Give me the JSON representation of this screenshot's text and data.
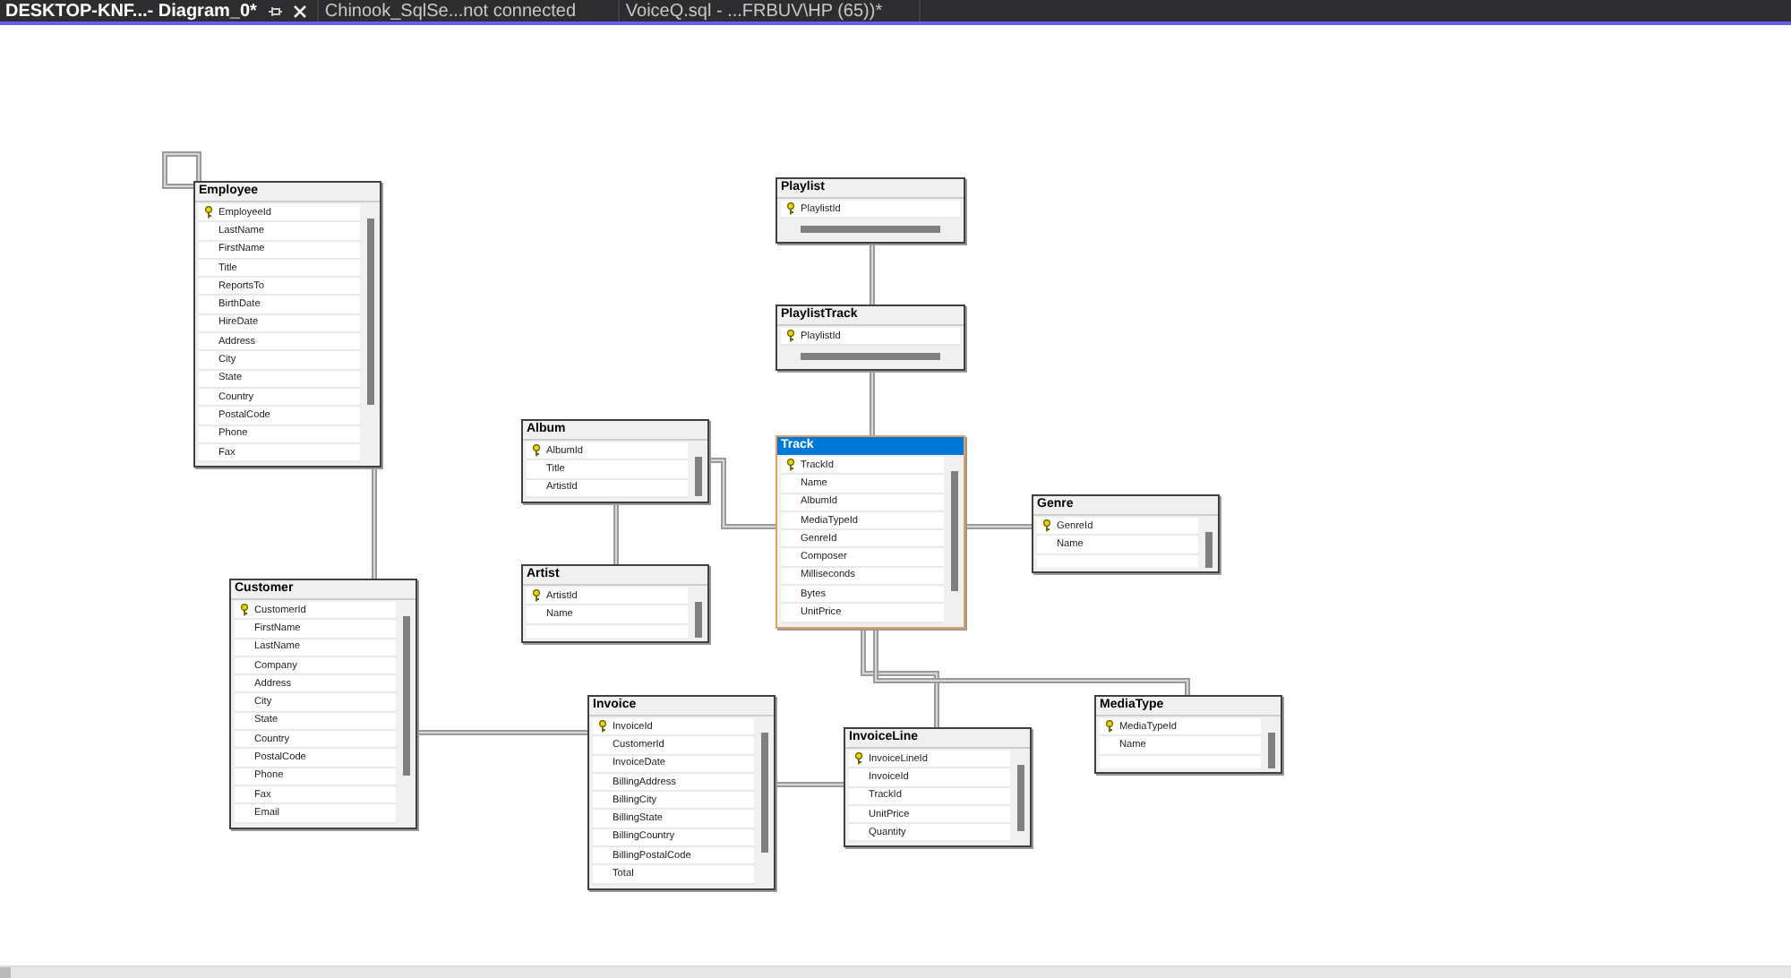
{
  "tabs": [
    {
      "label": "DESKTOP-KNF...- Diagram_0*",
      "selected": true
    },
    {
      "label": "Chinook_SqlSe...not connected",
      "selected": false
    },
    {
      "label": "VoiceQ.sql - ...FRBUV\\HP (65))*",
      "selected": false
    }
  ],
  "tables": [
    {
      "name": "Employee",
      "selected": false,
      "fields": [
        {
          "name": "EmployeeId",
          "key": true
        },
        {
          "name": "LastName",
          "key": false
        },
        {
          "name": "FirstName",
          "key": false
        },
        {
          "name": "Title",
          "key": false
        },
        {
          "name": "ReportsTo",
          "key": false
        },
        {
          "name": "BirthDate",
          "key": false
        },
        {
          "name": "HireDate",
          "key": false
        },
        {
          "name": "Address",
          "key": false
        },
        {
          "name": "City",
          "key": false
        },
        {
          "name": "State",
          "key": false
        },
        {
          "name": "Country",
          "key": false
        },
        {
          "name": "PostalCode",
          "key": false
        },
        {
          "name": "Phone",
          "key": false
        },
        {
          "name": "Fax",
          "key": false
        }
      ]
    },
    {
      "name": "Playlist",
      "selected": false,
      "fields": [
        {
          "name": "PlaylistId",
          "key": true
        }
      ]
    },
    {
      "name": "PlaylistTrack",
      "selected": false,
      "fields": [
        {
          "name": "PlaylistId",
          "key": true
        }
      ]
    },
    {
      "name": "Album",
      "selected": false,
      "fields": [
        {
          "name": "AlbumId",
          "key": true
        },
        {
          "name": "Title",
          "key": false
        },
        {
          "name": "ArtistId",
          "key": false
        }
      ]
    },
    {
      "name": "Track",
      "selected": true,
      "fields": [
        {
          "name": "TrackId",
          "key": true
        },
        {
          "name": "Name",
          "key": false
        },
        {
          "name": "AlbumId",
          "key": false
        },
        {
          "name": "MediaTypeId",
          "key": false
        },
        {
          "name": "GenreId",
          "key": false
        },
        {
          "name": "Composer",
          "key": false
        },
        {
          "name": "Milliseconds",
          "key": false
        },
        {
          "name": "Bytes",
          "key": false
        },
        {
          "name": "UnitPrice",
          "key": false
        }
      ]
    },
    {
      "name": "Genre",
      "selected": false,
      "fields": [
        {
          "name": "GenreId",
          "key": true
        },
        {
          "name": "Name",
          "key": false
        }
      ]
    },
    {
      "name": "Artist",
      "selected": false,
      "fields": [
        {
          "name": "ArtistId",
          "key": true
        },
        {
          "name": "Name",
          "key": false
        }
      ]
    },
    {
      "name": "Customer",
      "selected": false,
      "fields": [
        {
          "name": "CustomerId",
          "key": true
        },
        {
          "name": "FirstName",
          "key": false
        },
        {
          "name": "LastName",
          "key": false
        },
        {
          "name": "Company",
          "key": false
        },
        {
          "name": "Address",
          "key": false
        },
        {
          "name": "City",
          "key": false
        },
        {
          "name": "State",
          "key": false
        },
        {
          "name": "Country",
          "key": false
        },
        {
          "name": "PostalCode",
          "key": false
        },
        {
          "name": "Phone",
          "key": false
        },
        {
          "name": "Fax",
          "key": false
        },
        {
          "name": "Email",
          "key": false
        }
      ]
    },
    {
      "name": "Invoice",
      "selected": false,
      "fields": [
        {
          "name": "InvoiceId",
          "key": true
        },
        {
          "name": "CustomerId",
          "key": false
        },
        {
          "name": "InvoiceDate",
          "key": false
        },
        {
          "name": "BillingAddress",
          "key": false
        },
        {
          "name": "BillingCity",
          "key": false
        },
        {
          "name": "BillingState",
          "key": false
        },
        {
          "name": "BillingCountry",
          "key": false
        },
        {
          "name": "BillingPostalCode",
          "key": false
        },
        {
          "name": "Total",
          "key": false
        }
      ]
    },
    {
      "name": "MediaType",
      "selected": false,
      "fields": [
        {
          "name": "MediaTypeId",
          "key": true
        },
        {
          "name": "Name",
          "key": false
        }
      ]
    },
    {
      "name": "InvoiceLine",
      "selected": false,
      "fields": [
        {
          "name": "InvoiceLineId",
          "key": true
        },
        {
          "name": "InvoiceId",
          "key": false
        },
        {
          "name": "TrackId",
          "key": false
        },
        {
          "name": "UnitPrice",
          "key": false
        },
        {
          "name": "Quantity",
          "key": false
        }
      ]
    }
  ]
}
